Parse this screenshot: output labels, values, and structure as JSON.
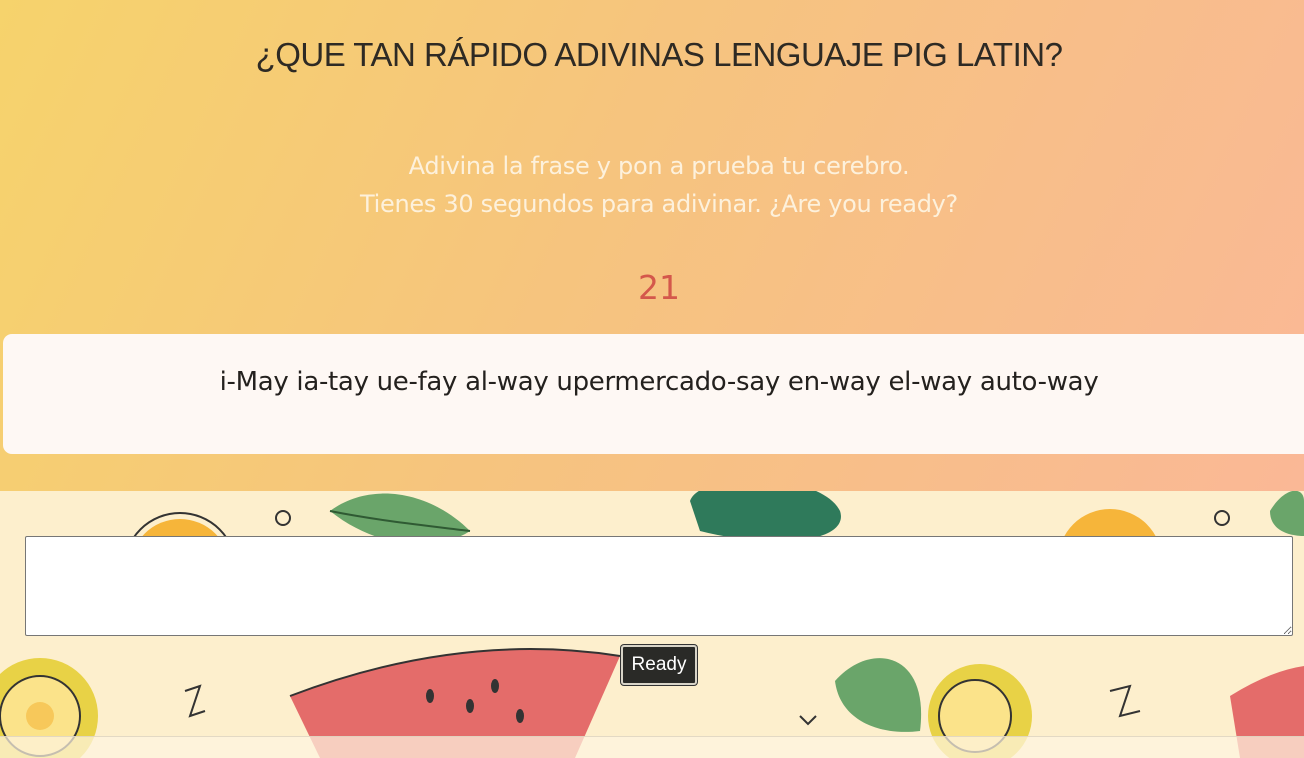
{
  "header": {
    "title": "¿QUE TAN RÁPIDO ADIVINAS LENGUAJE PIG LATIN?",
    "subtitle_line1": "Adivina la frase y pon a prueba tu cerebro.",
    "subtitle_line2": "Tienes 30 segundos para adivinar. ¿Are you ready?"
  },
  "game": {
    "timer": "21",
    "phrase": "i-May ia-tay ue-fay al-way upermercado-say en-way el-way auto-way",
    "answer_value": "",
    "ready_label": "Ready"
  },
  "colors": {
    "gradient_start": "#f6d36c",
    "gradient_end": "#fab896",
    "timer": "#d4574b",
    "button_bg": "#2a2a27"
  }
}
